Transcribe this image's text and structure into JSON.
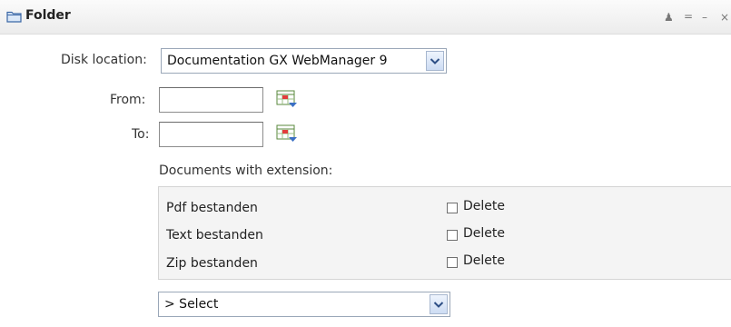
{
  "panel": {
    "title": "Folder",
    "controls": {
      "user": "♟",
      "menu": "=",
      "minimize": "–",
      "close": "×"
    }
  },
  "form": {
    "disk_location_label": "Disk location:",
    "disk_location_value": "Documentation GX WebManager 9",
    "from_label": "From:",
    "from_value": "",
    "to_label": "To:",
    "to_value": "",
    "extensions_heading": "Documents with extension:",
    "extensions": [
      {
        "label": "Pdf bestanden",
        "checkbox_label": "Delete",
        "checked": false
      },
      {
        "label": "Text bestanden",
        "checkbox_label": "Delete",
        "checked": false
      },
      {
        "label": "Zip bestanden",
        "checkbox_label": "Delete",
        "checked": false
      }
    ],
    "action_select_value": "> Select"
  },
  "colors": {
    "accent": "#3b67a6",
    "title_bar": "#f0f0f0",
    "extension_box": "#f4f4f4"
  },
  "icons": [
    "folder-icon",
    "user-icon",
    "menu-icon",
    "minimize-icon",
    "close-icon",
    "calendar-icon",
    "chevron-down-icon"
  ]
}
